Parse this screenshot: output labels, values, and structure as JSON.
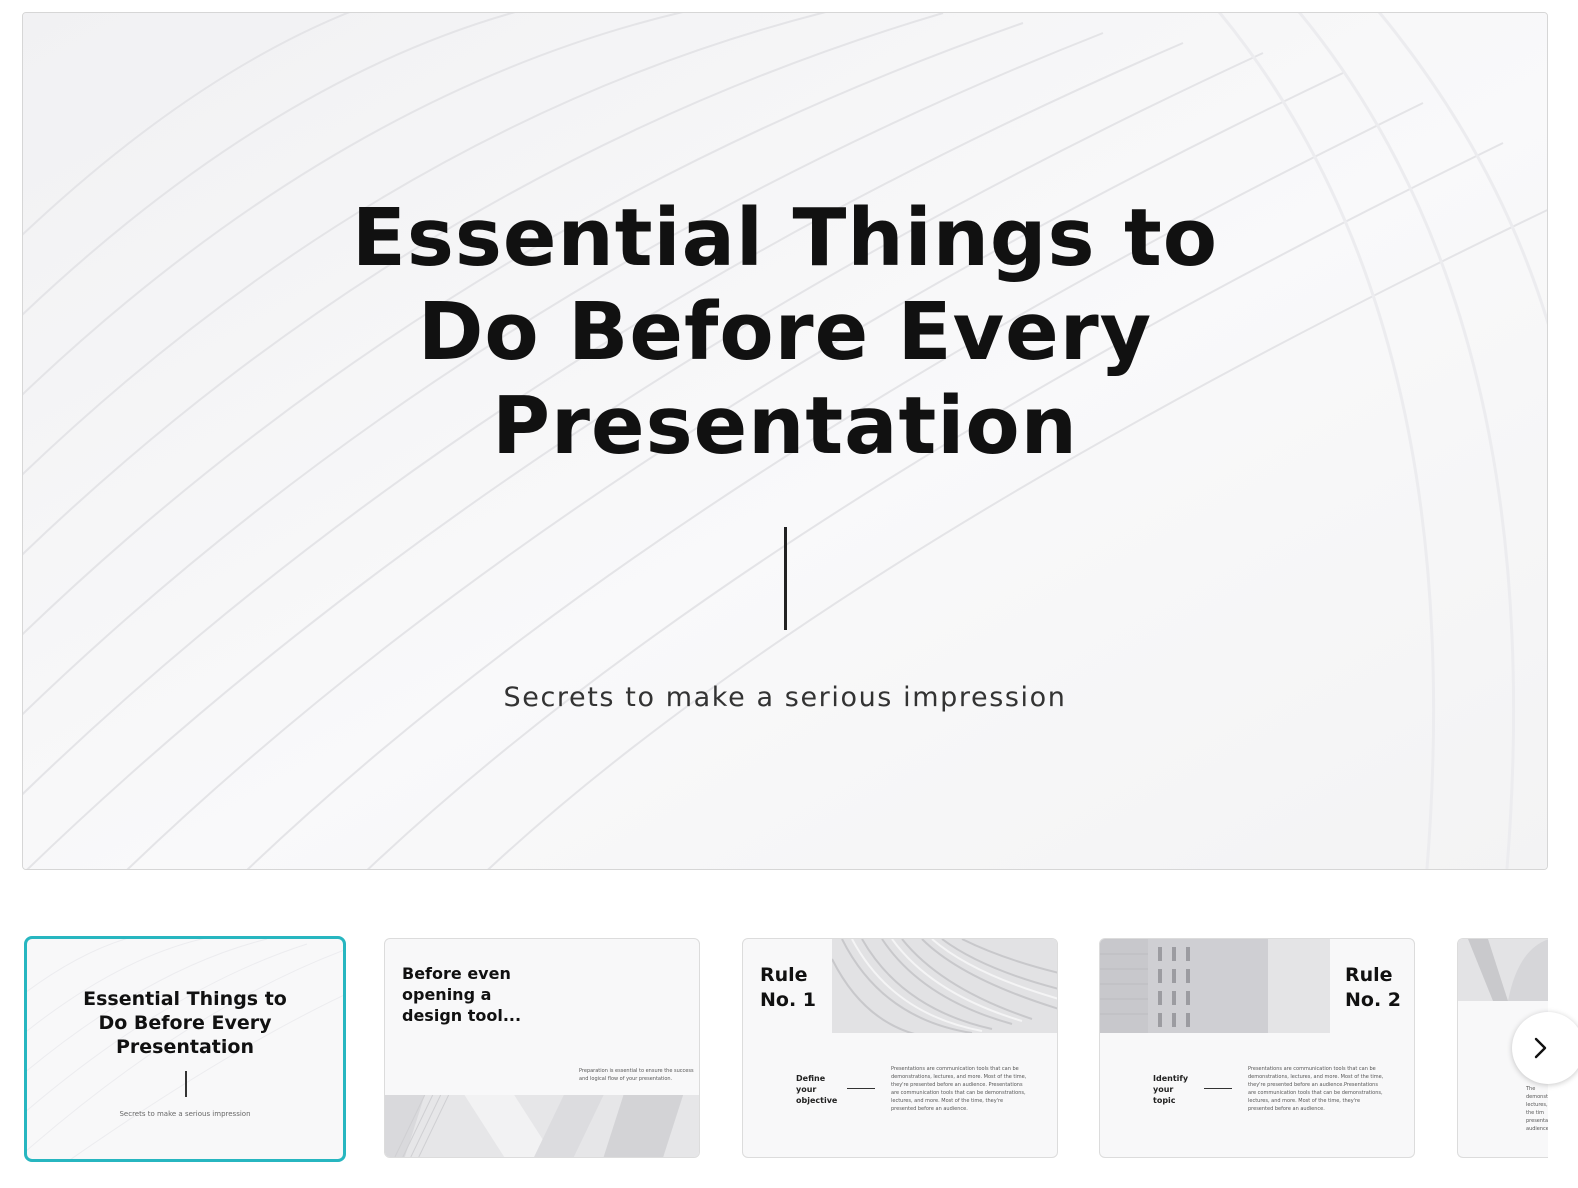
{
  "main_slide": {
    "title": "Essential Things to\nDo Before Every\nPresentation",
    "subtitle": "Secrets to make a serious impression"
  },
  "thumbnails": [
    {
      "title": "Essential Things to\nDo Before Every\nPresentation",
      "subtitle": "Secrets to make a serious impression",
      "selected": true
    },
    {
      "title": "Before even\nopening a\ndesign tool...",
      "text": "Preparation is essential to ensure the success and logical flow of your presentation."
    },
    {
      "title": "Rule\nNo. 1",
      "label": "Define\nyour\nobjective",
      "text": "Presentations are communication tools that can be demonstrations, lectures, and more. Most of the time, they're presented before an audience. Presentations are communication tools that can be demonstrations, lectures, and more. Most of the time, they're presented before an audience."
    },
    {
      "title": "Rule\nNo. 2",
      "label": "Identify\nyour\ntopic",
      "text": "Presentations are communication tools that can be demonstrations, lectures, and more. Most of the time, they're presented before an audience.Presentations are communication tools that can be demonstrations, lectures, and more. Most of the time, they're presented before an audience."
    },
    {
      "text": "The demonstr lectures, of the tim presentati audience"
    }
  ],
  "navigation": {
    "next_icon": "chevron-right-icon"
  },
  "colors": {
    "selected_border": "#27b6c0",
    "title_text": "#111111"
  }
}
